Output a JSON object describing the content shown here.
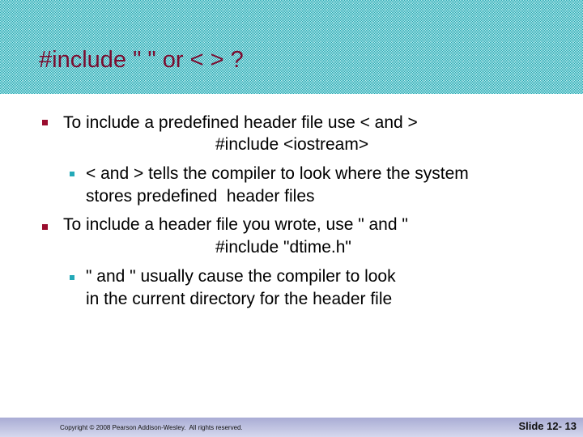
{
  "slide": {
    "title": "#include \" \" or < > ?",
    "bullets": [
      {
        "level": 1,
        "text": "To include a predefined header file use < and >",
        "code": "#include <iostream>",
        "sub_bullets": [
          {
            "level": 2,
            "lines": [
              "< and > tells the compiler to look where the system",
              "stores predefined  header files"
            ]
          }
        ]
      },
      {
        "level": 1,
        "text": "To include a header file you wrote, use \" and \"",
        "code": "#include \"dtime.h\"",
        "sub_bullets": [
          {
            "level": 2,
            "lines": [
              "\" and \" usually cause the compiler to look",
              "in the current directory for the header file"
            ]
          }
        ]
      }
    ],
    "bullet_icons": {
      "level1": "square-bullet-icon",
      "level2": "square-bullet-icon"
    },
    "colors": {
      "title": "#7a0b2e",
      "bullet_level1": "#9a0d2e",
      "bullet_level2": "#23a9b8",
      "header_pattern": "#1fa3ad",
      "footer": "#b8bbdc"
    }
  },
  "footer": {
    "copyright": "Copyright © 2008 Pearson Addison-Wesley.  All rights reserved.",
    "slide_number": "Slide 12- 13"
  }
}
